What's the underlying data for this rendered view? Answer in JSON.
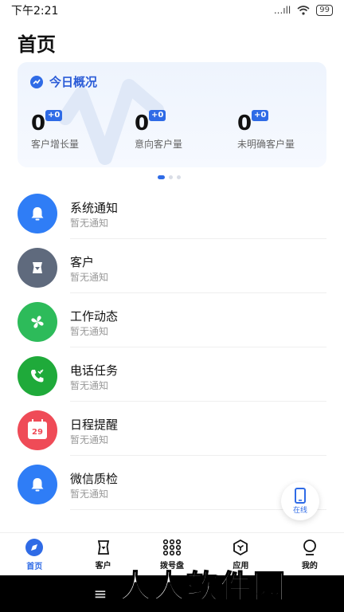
{
  "status_bar": {
    "time": "下午2:21",
    "signal_text": "...ıll",
    "battery": "99"
  },
  "page_title": "首页",
  "overview": {
    "title": "今日概况",
    "stats": [
      {
        "value": "0",
        "badge": "+0",
        "label": "客户增长量"
      },
      {
        "value": "0",
        "badge": "+0",
        "label": "意向客户量"
      },
      {
        "value": "0",
        "badge": "+0",
        "label": "未明确客户量"
      }
    ]
  },
  "list": [
    {
      "title": "系统通知",
      "subtitle": "暂无通知",
      "color": "#2f7df6",
      "icon": "bell-icon"
    },
    {
      "title": "客户",
      "subtitle": "暂无通知",
      "color": "#5f6a7d",
      "icon": "badge-icon"
    },
    {
      "title": "工作动态",
      "subtitle": "暂无通知",
      "color": "#2dbb5a",
      "icon": "fan-icon"
    },
    {
      "title": "电话任务",
      "subtitle": "暂无通知",
      "color": "#1faa3a",
      "icon": "phone-icon"
    },
    {
      "title": "日程提醒",
      "subtitle": "暂无通知",
      "color": "#ef4b57",
      "icon": "calendar-icon",
      "icon_text": "29"
    },
    {
      "title": "微信质检",
      "subtitle": "暂无通知",
      "color": "#2f7df6",
      "icon": "bell-icon"
    }
  ],
  "online_button": {
    "label": "在线"
  },
  "tabs": [
    {
      "label": "首页",
      "active": true
    },
    {
      "label": "客户"
    },
    {
      "label": "拨号盘"
    },
    {
      "label": "应用"
    },
    {
      "label": "我的"
    }
  ],
  "nav_bar": {
    "menu_glyph": "≡"
  },
  "watermark": "人人软件园",
  "colors": {
    "accent": "#2f6be6"
  }
}
